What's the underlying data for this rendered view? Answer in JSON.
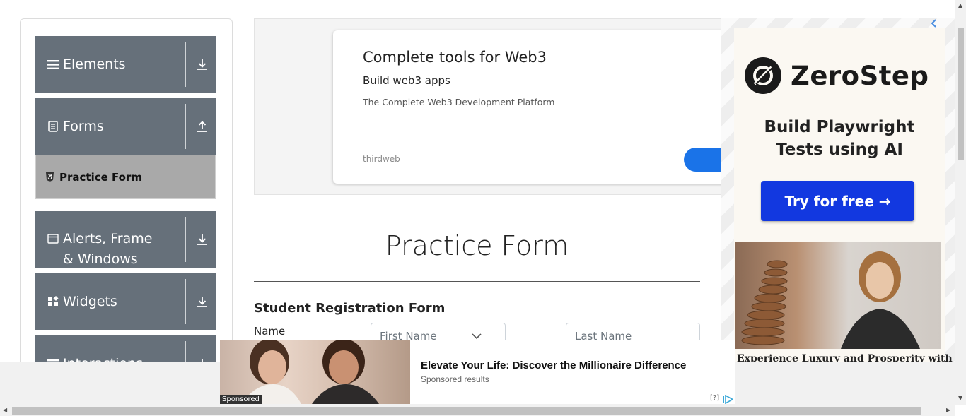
{
  "sidebar": {
    "groups": [
      {
        "label": "Elements",
        "icon": "hamburger-icon",
        "arrow": "download-arrow-icon"
      },
      {
        "label": "Forms",
        "icon": "document-icon",
        "arrow": "upload-arrow-icon"
      },
      {
        "label": "Alerts, Frame & Windows",
        "icon": "window-icon",
        "arrow": "download-arrow-icon"
      },
      {
        "label": "Widgets",
        "icon": "widgets-icon",
        "arrow": "download-arrow-icon"
      },
      {
        "label": "Interactions",
        "icon": "hamburger-icon",
        "arrow": "download-arrow-icon"
      }
    ],
    "active_item": {
      "label": "Practice Form",
      "icon": "html5-icon"
    }
  },
  "top_ad": {
    "title": "Complete tools for Web3",
    "subtitle": "Build web3 apps",
    "description": "The Complete Web3 Development Platform",
    "brand": "thirdweb"
  },
  "form": {
    "page_title": "Practice Form",
    "section_title": "Student Registration Form",
    "name_label": "Name",
    "first_name_placeholder": "First Name",
    "last_name_placeholder": "Last Name"
  },
  "right_ad": {
    "brand": "ZeroStep",
    "headline_line1": "Build Playwright",
    "headline_line2": "Tests using AI",
    "cta": "Try for free →",
    "caption": "Experience Luxury and Prosperity with"
  },
  "bottom_ad": {
    "sponsored_tag": "Sponsored",
    "title": "Elevate Your Life: Discover the Millionaire Difference",
    "subtitle": "Sponsored results",
    "info_marker": "[?]"
  },
  "colors": {
    "sidebar_group": "#66707a",
    "active_item": "#a9a9a9",
    "cta_blue": "#1238e0"
  }
}
